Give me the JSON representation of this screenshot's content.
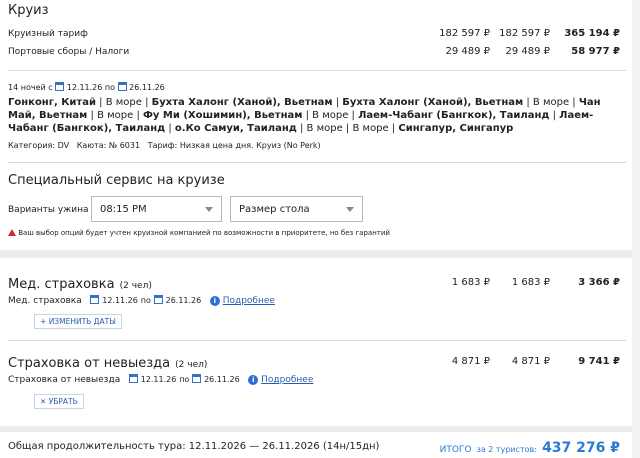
{
  "cruise": {
    "title": "Круиз",
    "rows": [
      {
        "label": "Круизный тариф",
        "v1": "182 597 ₽",
        "v2": "182 597 ₽",
        "total": "365 194 ₽"
      },
      {
        "label": "Портовые сборы / Налоги",
        "v1": "29 489 ₽",
        "v2": "29 489 ₽",
        "total": "58 977 ₽"
      }
    ],
    "nights": "14 ночей с",
    "date_from": "12.11.26",
    "date_sep": "по",
    "date_to": "26.11.26",
    "route": [
      {
        "t": "Гонконг, Китай",
        "b": true
      },
      {
        "t": " | В море | ",
        "b": false
      },
      {
        "t": "Бухта Халонг (Ханой), Вьетнам",
        "b": true
      },
      {
        "t": " | ",
        "b": false
      },
      {
        "t": "Бухта Халонг (Ханой), Вьетнам",
        "b": true
      },
      {
        "t": " | В море | ",
        "b": false
      },
      {
        "t": "Чан Май, Вьетнам",
        "b": true
      },
      {
        "t": " | В море | ",
        "b": false
      },
      {
        "t": "Фу Ми (Хошимин), Вьетнам",
        "b": true
      },
      {
        "t": " | В море | ",
        "b": false
      },
      {
        "t": "Лаем-Чабанг (Бангкок), Таиланд",
        "b": true
      },
      {
        "t": " | ",
        "b": false
      },
      {
        "t": "Лаем-Чабанг (Бангкок), Таиланд",
        "b": true
      },
      {
        "t": " | ",
        "b": false
      },
      {
        "t": "о.Ко Самуи, Таиланд",
        "b": true
      },
      {
        "t": " | В море | В море | ",
        "b": false
      },
      {
        "t": "Сингапур, Сингапур",
        "b": true
      }
    ],
    "category": "Категория: DV",
    "cabin": "Каюта: № 6031",
    "tariff": "Тариф: Низкая цена дня. Круиз (No Perk)"
  },
  "special": {
    "title": "Специальный сервис на круизе",
    "dinner_label": "Варианты ужина",
    "dinner_value": "08:15 PM",
    "table_value": "Размер стола",
    "notice": "Ваш выбор опций будет учтен круизной компанией по возможности в приоритете, но без гарантий"
  },
  "med": {
    "title": "Мед. страховка",
    "people": "(2 чел)",
    "v1": "1 683 ₽",
    "v2": "1 683 ₽",
    "total": "3 366 ₽",
    "label": "Мед. страховка",
    "date_from": "12.11.26",
    "date_sep": "по",
    "date_to": "26.11.26",
    "details": "Подробнее",
    "button": "ИЗМЕНИТЬ ДАТЫ"
  },
  "cancel": {
    "title": "Страховка от невыезда",
    "people": "(2 чел)",
    "v1": "4 871 ₽",
    "v2": "4 871 ₽",
    "total": "9 741 ₽",
    "label": "Страховка от невыезда",
    "date_from": "12.11.26",
    "date_sep": "по",
    "date_to": "26.11.26",
    "details": "Подробнее",
    "button": "УБРАТЬ"
  },
  "footer": {
    "duration": "Общая продолжительность тура: 12.11.2026 — 26.11.2026 (14н/15дн)",
    "total_label": "ИТОГО",
    "total_sub": "за 2 туристов:",
    "total_value": "437 276 ₽"
  }
}
